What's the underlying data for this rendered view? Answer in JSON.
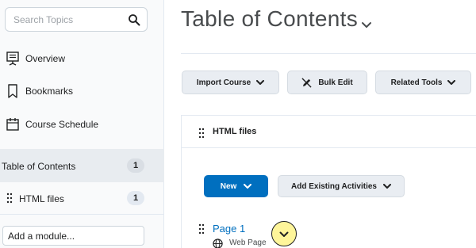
{
  "sidebar": {
    "search": {
      "placeholder": "Search Topics",
      "icon": "search-icon"
    },
    "items": [
      {
        "label": "Overview",
        "icon": "overview-icon"
      },
      {
        "label": "Bookmarks",
        "icon": "bookmark-icon"
      },
      {
        "label": "Course Schedule",
        "icon": "calendar-icon"
      }
    ],
    "toc": {
      "label": "Table of Contents",
      "count": "1"
    },
    "module": {
      "label": "HTML files",
      "count": "1",
      "icon": "drag-handle-icon"
    },
    "add_module": {
      "value": "Add a module..."
    }
  },
  "main": {
    "title": "Table of Contents",
    "toolbar": {
      "import_label": "Import Course",
      "bulk_edit_label": "Bulk Edit",
      "related_tools_label": "Related Tools"
    },
    "module": {
      "title": "HTML files",
      "new_label": "New",
      "add_existing_label": "Add Existing Activities",
      "topics": [
        {
          "title": "Page 1",
          "type": "Web Page",
          "type_icon": "globe-icon"
        }
      ]
    }
  },
  "colors": {
    "accent": "#006fbf",
    "highlight": "#fef59a",
    "sidebar_bg": "#f9fafb",
    "selected_bg": "#e8ecf0"
  }
}
